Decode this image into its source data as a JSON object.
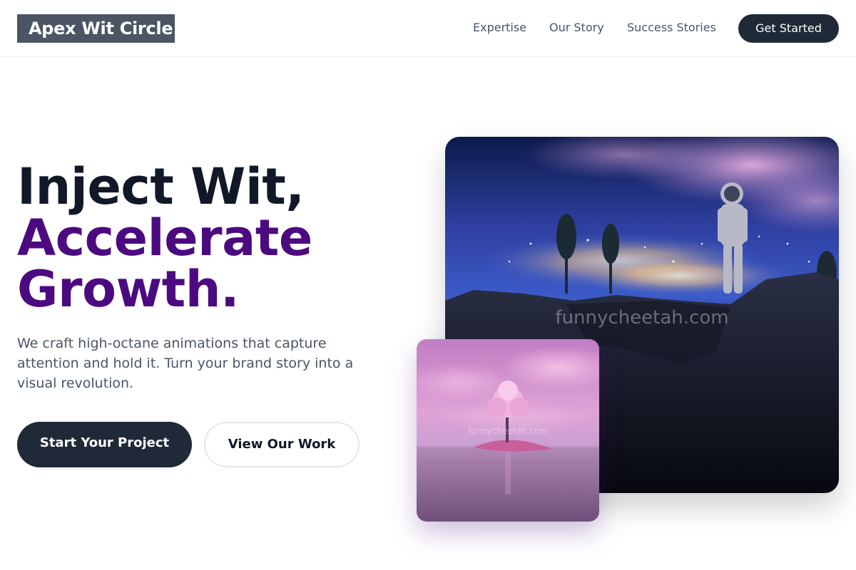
{
  "brand": {
    "name": "Apex Wit Circle"
  },
  "nav": {
    "items": [
      {
        "label": "Expertise"
      },
      {
        "label": "Our Story"
      },
      {
        "label": "Success Stories"
      }
    ],
    "cta_label": "Get Started"
  },
  "hero": {
    "headline_line1": "Inject Wit,",
    "headline_line2": "Accelerate",
    "headline_line3": "Growth.",
    "subtext": "We craft high-octane animations that capture attention and hold it. Turn your brand story into a visual revolution.",
    "primary_button": "Start Your Project",
    "secondary_button": "View Our Work"
  },
  "images": {
    "main": {
      "subject": "astronaut-on-cliff-over-night-city",
      "watermark": "funnycheetah.com"
    },
    "secondary": {
      "subject": "pink-tree-on-island-in-water",
      "watermark": "funnycheetah.com"
    }
  },
  "colors": {
    "accent_purple": "#4c0a80",
    "dark": "#1f2937",
    "logo_bg": "#4b5563"
  }
}
